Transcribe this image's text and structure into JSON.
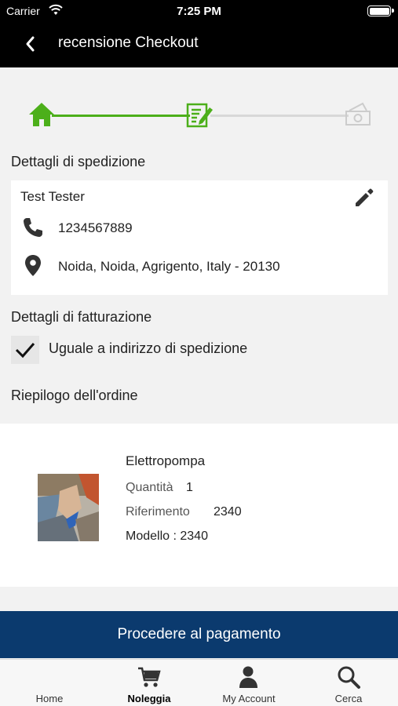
{
  "status_bar": {
    "carrier": "Carrier",
    "time": "7:25 PM"
  },
  "nav": {
    "title": "recensione Checkout"
  },
  "progress": {
    "steps": [
      {
        "name": "home-step",
        "state": "done"
      },
      {
        "name": "review-step",
        "state": "current"
      },
      {
        "name": "payment-step",
        "state": "todo"
      }
    ],
    "colors": {
      "done": "#4caf1a",
      "todo": "#cccccc"
    }
  },
  "shipping": {
    "title": "Dettagli di spedizione",
    "name": "Test Tester",
    "phone": "1234567889",
    "address": "Noida, Noida, Agrigento, Italy - 20130"
  },
  "billing": {
    "title": "Dettagli di fatturazione",
    "same_as_shipping_label": "Uguale a indirizzo di spedizione",
    "same_as_shipping_checked": true
  },
  "order_summary": {
    "title": "Riepilogo dell'ordine",
    "item": {
      "name": "Elettropompa",
      "quantity_label": "Quantità",
      "quantity": "1",
      "reference_label": "Riferimento",
      "reference": "2340",
      "model_text": "Modello : 2340"
    }
  },
  "actions": {
    "proceed_label": "Procedere al pagamento"
  },
  "tab_bar": {
    "tabs": [
      {
        "label": "Home",
        "icon": "home-icon",
        "active": false
      },
      {
        "label": "Noleggia",
        "icon": "cart-icon",
        "active": true
      },
      {
        "label": "My Account",
        "icon": "user-icon",
        "active": false
      },
      {
        "label": "Cerca",
        "icon": "search-icon",
        "active": false
      }
    ]
  },
  "colors": {
    "nav_bg": "#000000",
    "button_bg": "#0b3a6e",
    "accent_green": "#4caf1a"
  }
}
